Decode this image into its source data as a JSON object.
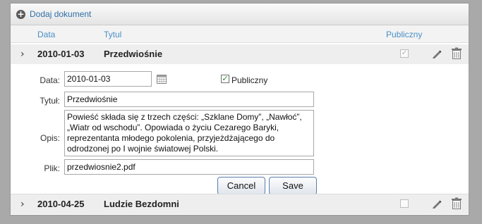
{
  "toolbar": {
    "add_label": "Dodaj dokument"
  },
  "columns": {
    "date": "Data",
    "title": "Tytul",
    "public": "Publiczny"
  },
  "rows": [
    {
      "date": "2010-01-03",
      "title": "Przedwiośnie",
      "public": true
    },
    {
      "date": "2010-04-25",
      "title": "Ludzie Bezdomni",
      "public": false
    }
  ],
  "form": {
    "date_label": "Data:",
    "date_value": "2010-01-03",
    "public_label": "Publiczny",
    "public_checked": true,
    "title_label": "Tytuł:",
    "title_value": "Przedwiośnie",
    "desc_label": "Opis:",
    "desc_value": "Powieść składa się z trzech części: „Szklane Domy”, „Nawłoć”, „Wiatr od wschodu”. Opowiada o życiu Cezarego Baryki, reprezentanta młodego pokolenia, przyjeżdżającego do odrodzonej po I wojnie światowej Polski.",
    "file_label": "Plik:",
    "file_value": "przedwiosnie2.pdf",
    "cancel_label": "Cancel",
    "save_label": "Save"
  }
}
